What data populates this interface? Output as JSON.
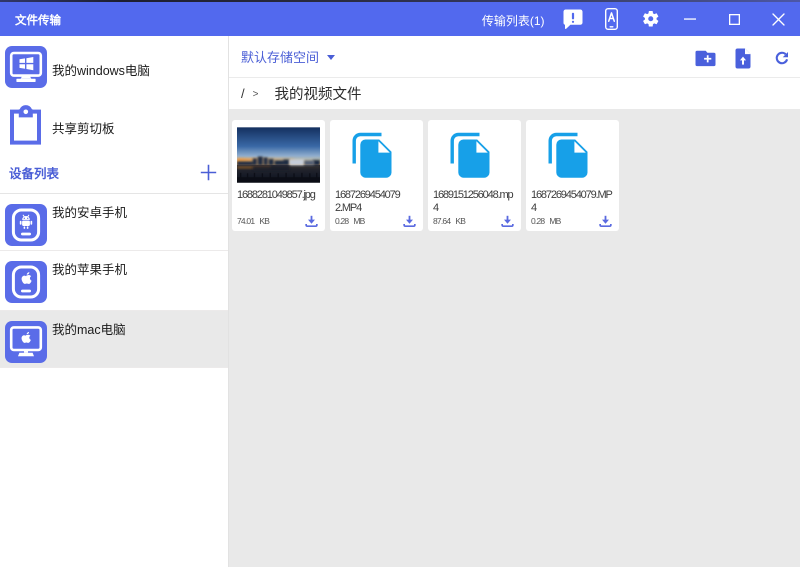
{
  "titlebar": {
    "title": "文件传输",
    "transfer_list_label": "传输列表(1)",
    "icons": [
      "feedback-bubble-icon",
      "phone-app-icon",
      "gear-icon",
      "minimize-icon",
      "maximize-icon",
      "close-icon"
    ]
  },
  "sidebar": {
    "items": [
      {
        "label": "我的windows电脑",
        "icon": "windows-computer-icon"
      },
      {
        "label": "共享剪切板",
        "icon": "clipboard-icon"
      }
    ],
    "device_section": {
      "label": "设备列表",
      "add_label": "+"
    },
    "devices": [
      {
        "label": "我的安卓手机",
        "icon": "android-phone-icon",
        "selected": false
      },
      {
        "label": "我的苹果手机",
        "icon": "apple-phone-icon",
        "selected": false
      },
      {
        "label": "我的mac电脑",
        "icon": "mac-computer-icon",
        "selected": true
      }
    ]
  },
  "toolbar": {
    "storage_selector": "默认存储空间",
    "actions": [
      "new-folder-icon",
      "upload-file-icon",
      "refresh-icon"
    ]
  },
  "breadcrumb": {
    "root": "/",
    "separator": ">",
    "current": "我的视频文件"
  },
  "files": [
    {
      "name": "1688281049857.jpg",
      "size": "74.01 KB",
      "kind": "image-thumbnail"
    },
    {
      "name": "1687269454079 2.MP4",
      "size": "0.28 MB",
      "kind": "file-copy-icon"
    },
    {
      "name": "1689151256048.mp4",
      "size": "87.64 KB",
      "kind": "file-copy-icon"
    },
    {
      "name": "1687269454079.MP4",
      "size": "0.28 MB",
      "kind": "file-copy-icon"
    }
  ],
  "colors": {
    "titlebar": "#5269ee",
    "accent_blue": "#4a5ed6",
    "icon_blue": "#5a6ce8",
    "file_icon_azure": "#17a0e8",
    "content_bg": "#e9e9e9"
  }
}
